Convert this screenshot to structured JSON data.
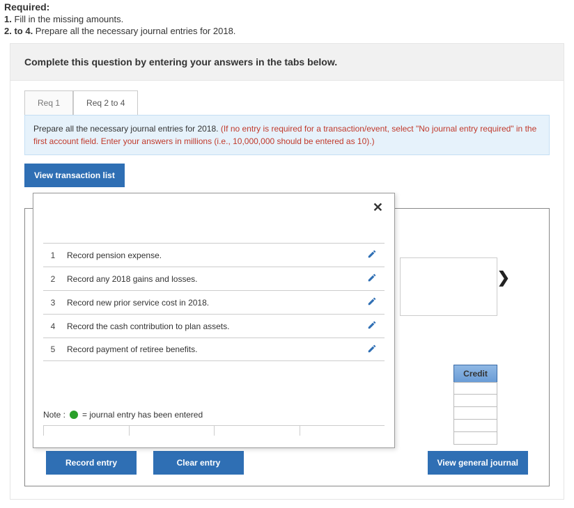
{
  "required": {
    "title": "Required:",
    "line1_num": "1.",
    "line1_text": " Fill in the missing amounts.",
    "line2_num": "2. to 4.",
    "line2_text": " Prepare all the necessary journal entries for 2018."
  },
  "panel": {
    "header": "Complete this question by entering your answers in the tabs below.",
    "tabs": {
      "tab1": "Req 1",
      "tab2": "Req 2 to 4"
    },
    "note_main": "Prepare all the necessary journal entries for 2018. ",
    "note_red": "(If no entry is required for a transaction/event, select \"No journal entry required\" in the first account field. Enter your answers in millions (i.e., 10,000,000 should be entered as 10).)"
  },
  "buttons": {
    "view_transactions": "View transaction list",
    "record_entry": "Record entry",
    "clear_entry": "Clear entry",
    "view_journal": "View general journal"
  },
  "table": {
    "credit_header": "Credit"
  },
  "transactions": {
    "close_label": "✕",
    "arrow_right": "❯",
    "items": [
      {
        "num": "1",
        "desc": "Record pension expense."
      },
      {
        "num": "2",
        "desc": "Record any 2018 gains and losses."
      },
      {
        "num": "3",
        "desc": "Record new prior service cost in 2018."
      },
      {
        "num": "4",
        "desc": "Record the cash contribution to plan assets."
      },
      {
        "num": "5",
        "desc": "Record payment of retiree benefits."
      }
    ],
    "note_prefix": "Note :",
    "note_text": "= journal entry has been entered"
  }
}
